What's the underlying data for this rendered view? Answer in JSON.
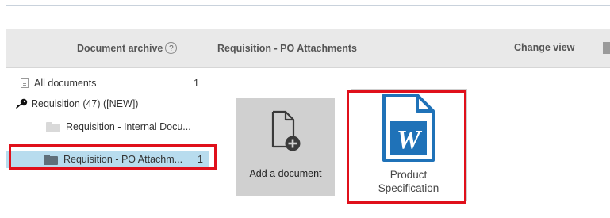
{
  "header": {
    "archive_label": "Document archive",
    "help_glyph": "?",
    "title": "Requisition - PO Attachments",
    "change_view_label": "Change view"
  },
  "sidebar": {
    "items": [
      {
        "label": "All documents",
        "count": "1",
        "icon": "document-icon"
      },
      {
        "label": "Requisition (47) ([NEW])",
        "count": "",
        "icon": "key-icon"
      },
      {
        "label": "Requisition - Internal Docu...",
        "count": "",
        "icon": "folder-icon"
      },
      {
        "label": "Requisition - PO Attachm...",
        "count": "1",
        "icon": "folder-icon",
        "selected": true
      }
    ]
  },
  "main": {
    "add_document_label": "Add a document",
    "documents": [
      {
        "name_line1": "Product",
        "name_line2": "Specification",
        "icon": "word-document-icon",
        "icon_letter": "W"
      }
    ]
  },
  "colors": {
    "highlight_border": "#e0101b",
    "selected_row": "#b8dcee",
    "word_blue": "#1f72b8",
    "header_bg": "#e9e9e9"
  }
}
